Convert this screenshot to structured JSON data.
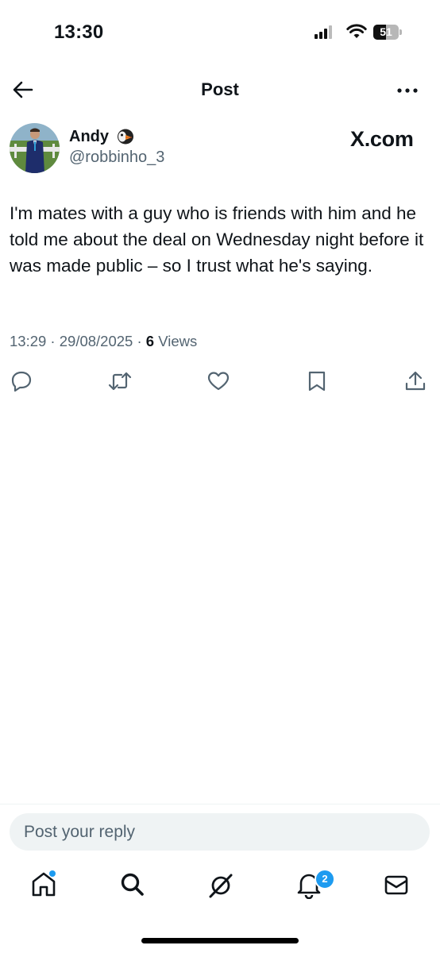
{
  "status_bar": {
    "time": "13:30",
    "battery": "51",
    "battery_level": 0.51
  },
  "nav": {
    "title": "Post"
  },
  "post": {
    "author_name": "Andy",
    "author_handle": "@robbinho_3",
    "source_label": "X.com",
    "text": "I'm mates with a guy who is friends with him and he told me about the deal on Wednesday night before it was made public – so I trust what he's saying.",
    "timestamp": "13:29 · 29/08/2025 · ",
    "views_count": "6",
    "views_label": " Views"
  },
  "reply": {
    "placeholder": "Post your reply"
  },
  "tabbar": {
    "notifications_badge": "2"
  },
  "colors": {
    "accent": "#1d9bf0",
    "text": "#0f1419",
    "muted": "#536471"
  }
}
